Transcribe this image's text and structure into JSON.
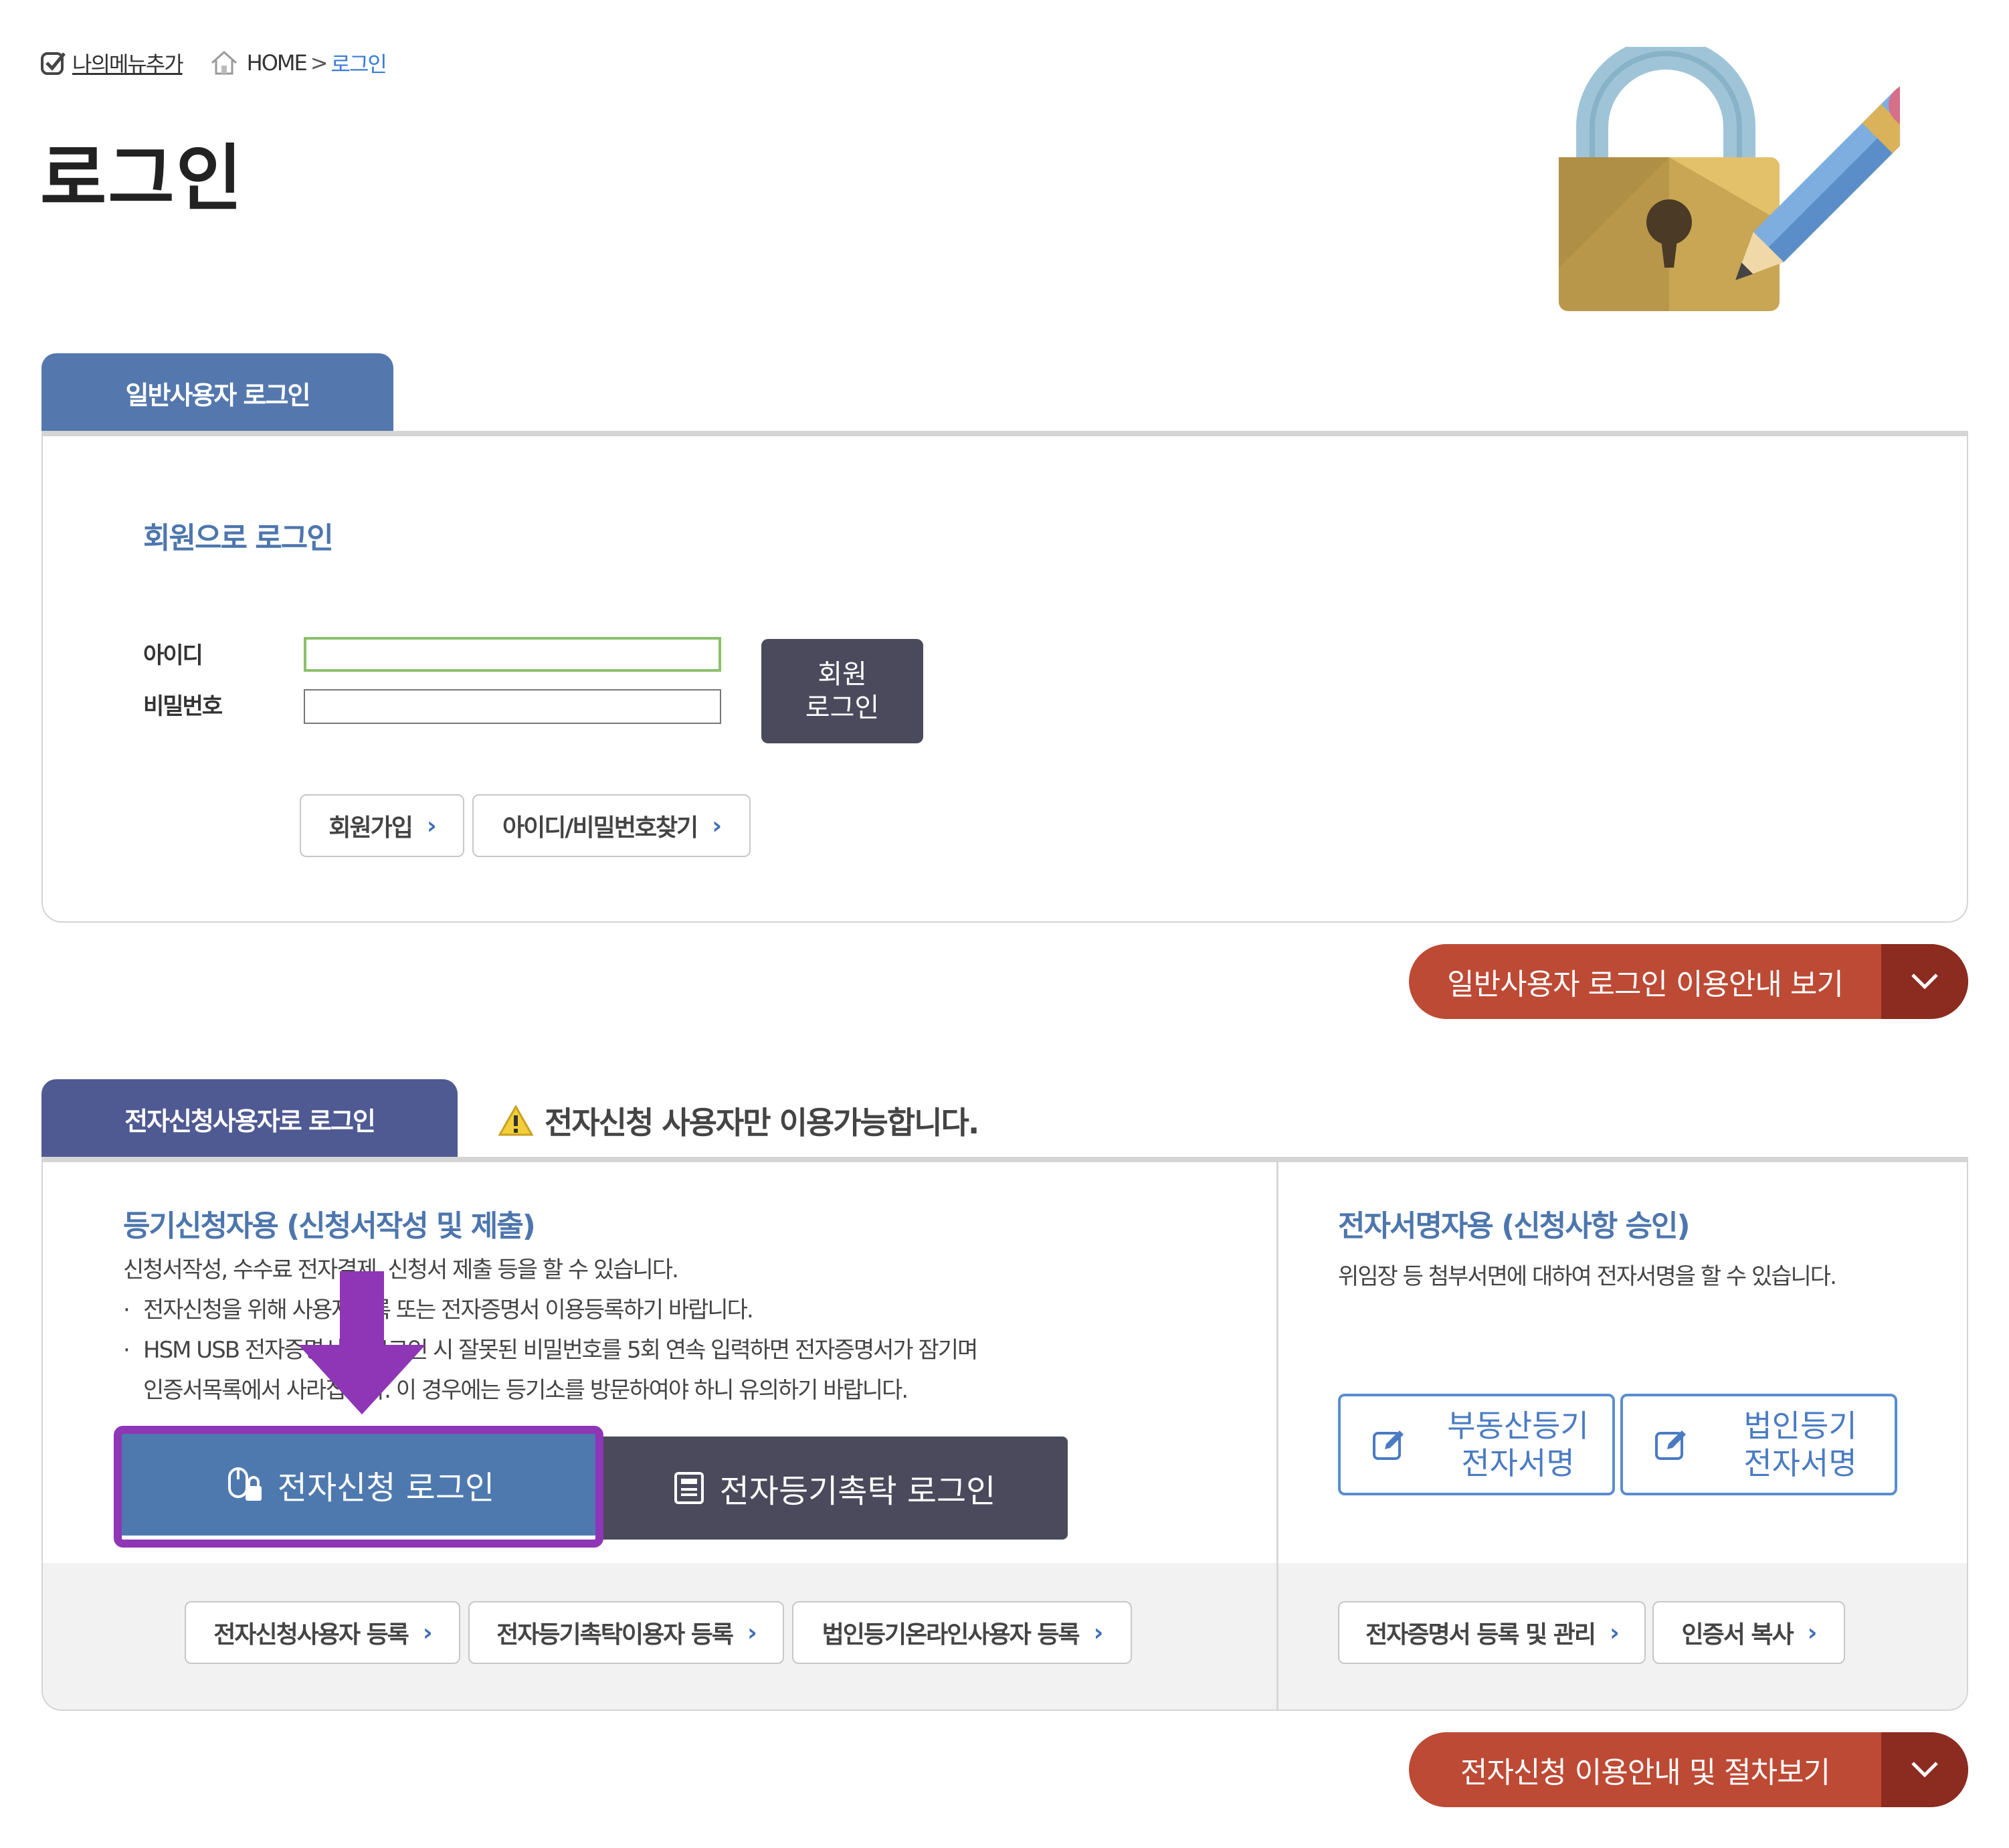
{
  "breadcrumb": {
    "my_menu": "나의메뉴추가",
    "home": "HOME",
    "sep": ">",
    "current": "로그인"
  },
  "page_title": "로그인",
  "general": {
    "tab": "일반사용자 로그인",
    "subtitle": "회원으로 로그인",
    "id_label": "아이디",
    "pw_label": "비밀번호",
    "id_value": "",
    "pw_value": "",
    "login_line1": "회원",
    "login_line2": "로그인",
    "join": "회원가입",
    "find": "아이디/비밀번호찾기",
    "guide": "일반사용자 로그인 이용안내 보기"
  },
  "electronic": {
    "tab": "전자신청사용자로 로그인",
    "warning": "전자신청 사용자만 이용가능합니다.",
    "left_title": "등기신청자용 (신청서작성 및 제출)",
    "desc1": "신청서작성, 수수료 전자결제, 신청서 제출 등을 할 수 있습니다.",
    "bullet1": "전자신청을 위해 사용자등록 또는 전자증명서 이용등록하기 바랍니다.",
    "bullet2a": "HSM USB 전자증명서로 로그인 시 잘못된 비밀번호를 5회 연속 입력하면 전자증명서가 잠기며",
    "bullet2b": "인증서목록에서 사라집니다. 이 경우에는 등기소를 방문하여야 하니 유의하기 바랍니다.",
    "esign_login": "전자신청 로그인",
    "trust_login": "전자등기촉탁 로그인",
    "reg1": "전자신청사용자 등록",
    "reg2": "전자등기촉탁이용자 등록",
    "reg3": "법인등기온라인사용자 등록",
    "right_title": "전자서명자용 (신청사항 승인)",
    "right_desc": "위임장 등 첨부서면에 대하여 전자서명을 할 수 있습니다.",
    "realestate_line1": "부동산등기",
    "realestate_line2": "전자서명",
    "corp_line1": "법인등기",
    "corp_line2": "전자서명",
    "cert_manage": "전자증명서 등록 및 관리",
    "cert_copy": "인증서 복사",
    "guide": "전자신청 이용안내 및 절차보기"
  },
  "colors": {
    "tab_general": "#5478ad",
    "tab_electronic": "#4f5992",
    "guide_button": "#bd4a35",
    "highlight": "#8e36b5"
  }
}
